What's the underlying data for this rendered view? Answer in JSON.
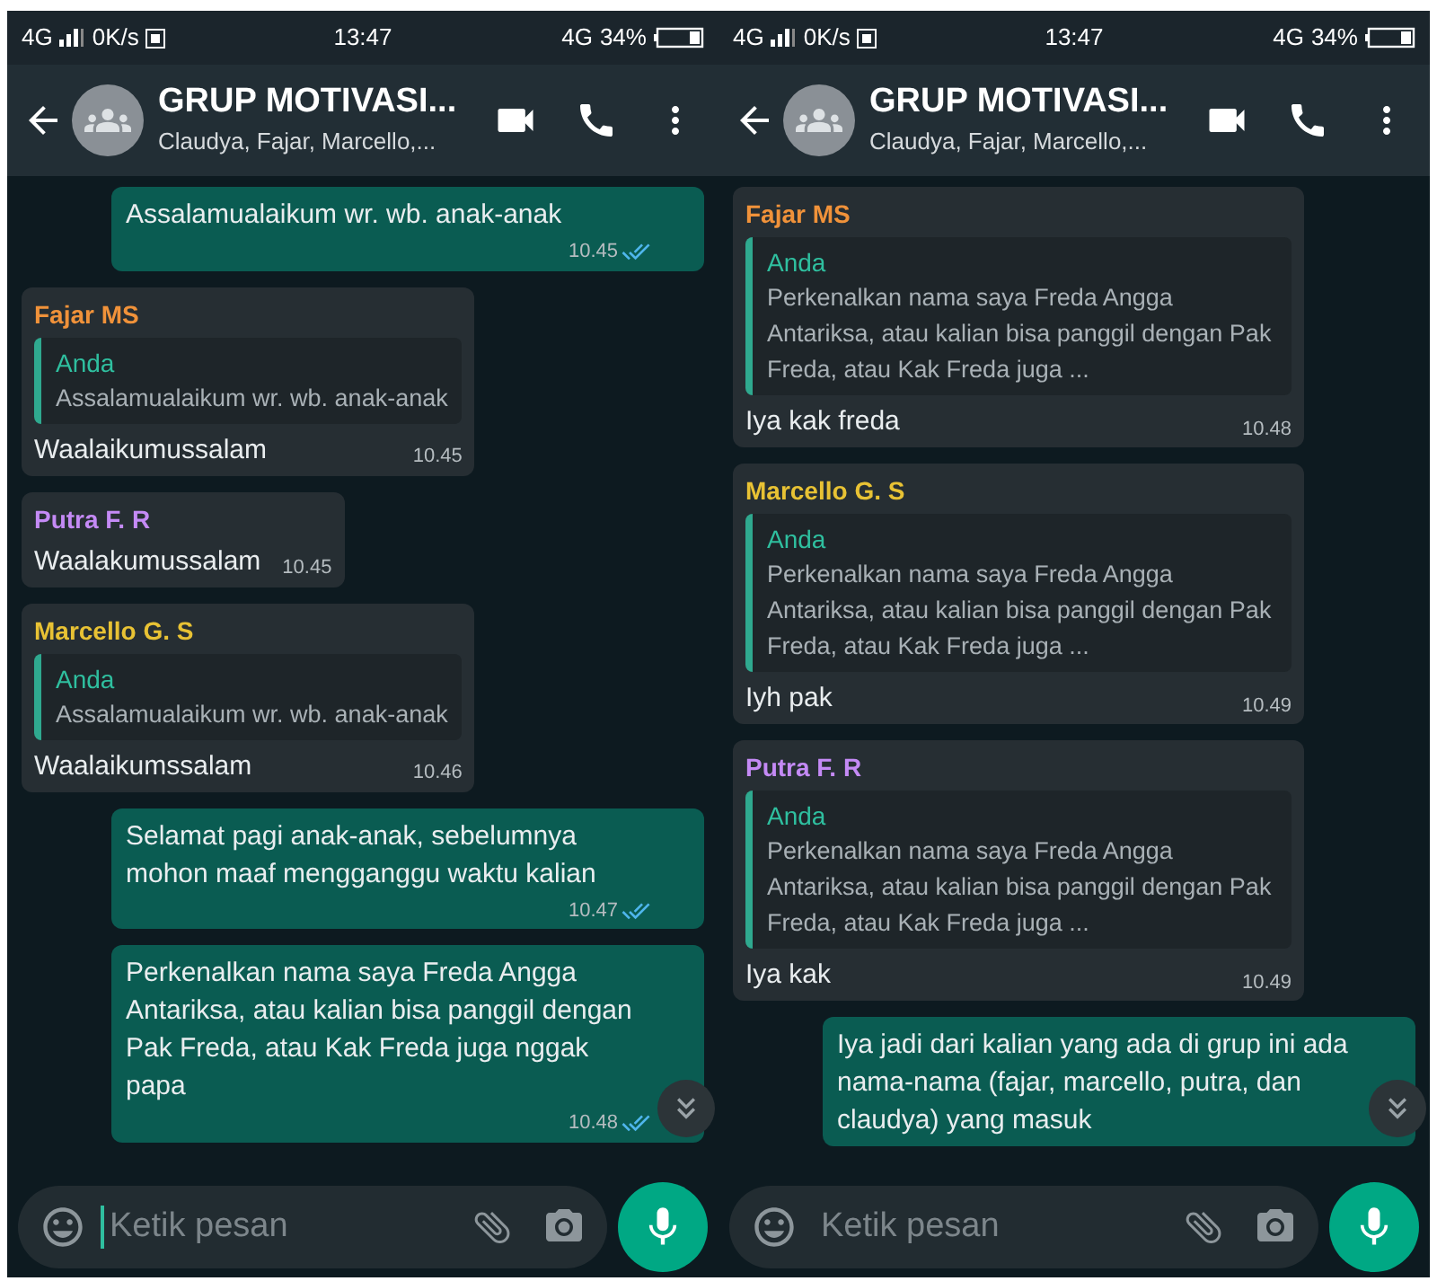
{
  "phones": [
    {
      "status_bar": {
        "network": "4G",
        "speed": "0K/s",
        "time": "13:47",
        "network_right": "4G",
        "battery": "34%"
      },
      "header": {
        "title": "GRUP MOTIVASI...",
        "subtitle": "Claudya, Fajar, Marcello,..."
      },
      "messages": [
        {
          "kind": "out",
          "text": "Assalamualaikum wr. wb. anak-anak",
          "time": "10.45",
          "read": true
        },
        {
          "kind": "in",
          "sender": "Fajar MS",
          "color": "#f0923a",
          "quote": {
            "author": "Anda",
            "text": "Assalamualaikum wr. wb. anak-anak"
          },
          "text": "Waalaikumussalam",
          "time": "10.45"
        },
        {
          "kind": "in",
          "sender": "Putra F. R",
          "color": "#c48af5",
          "text": "Waalakumussalam",
          "time": "10.45"
        },
        {
          "kind": "in",
          "sender": "Marcello G. S",
          "color": "#e8c234",
          "quote": {
            "author": "Anda",
            "text": "Assalamualaikum wr. wb. anak-anak"
          },
          "text": "Waalaikumssalam",
          "time": "10.46"
        },
        {
          "kind": "out",
          "text": "Selamat pagi anak-anak, sebelumnya mohon maaf mengganggu waktu kalian",
          "time": "10.47",
          "read": true
        },
        {
          "kind": "out",
          "text": "Perkenalkan nama saya Freda Angga Antariksa, atau kalian bisa panggil dengan Pak Freda, atau Kak Freda juga nggak papa",
          "time": "10.48",
          "read": true
        }
      ],
      "composer": {
        "placeholder": "Ketik pesan",
        "focused": true
      }
    },
    {
      "status_bar": {
        "network": "4G",
        "speed": "0K/s",
        "time": "13:47",
        "network_right": "4G",
        "battery": "34%"
      },
      "header": {
        "title": "GRUP MOTIVASI...",
        "subtitle": "Claudya, Fajar, Marcello,..."
      },
      "messages": [
        {
          "kind": "in",
          "sender": "Fajar MS",
          "color": "#f0923a",
          "quote": {
            "author": "Anda",
            "text": "Perkenalkan nama saya Freda Angga Antariksa, atau kalian bisa panggil dengan Pak Freda, atau Kak Freda juga ..."
          },
          "text": "Iya kak freda",
          "time": "10.48"
        },
        {
          "kind": "in",
          "sender": "Marcello G. S",
          "color": "#e8c234",
          "quote": {
            "author": "Anda",
            "text": "Perkenalkan nama saya Freda Angga Antariksa, atau kalian bisa panggil dengan Pak Freda, atau Kak Freda juga ..."
          },
          "text": "Iyh pak",
          "time": "10.49"
        },
        {
          "kind": "in",
          "sender": "Putra F. R",
          "color": "#c48af5",
          "quote": {
            "author": "Anda",
            "text": "Perkenalkan nama saya Freda Angga Antariksa, atau kalian bisa panggil dengan Pak Freda, atau Kak Freda juga ..."
          },
          "text": "Iya kak",
          "time": "10.49"
        },
        {
          "kind": "out",
          "text": "Iya jadi dari kalian yang ada di grup ini ada nama-nama (fajar, marcello, putra, dan claudya) yang masuk"
        }
      ],
      "composer": {
        "placeholder": "Ketik pesan",
        "focused": false
      }
    }
  ]
}
